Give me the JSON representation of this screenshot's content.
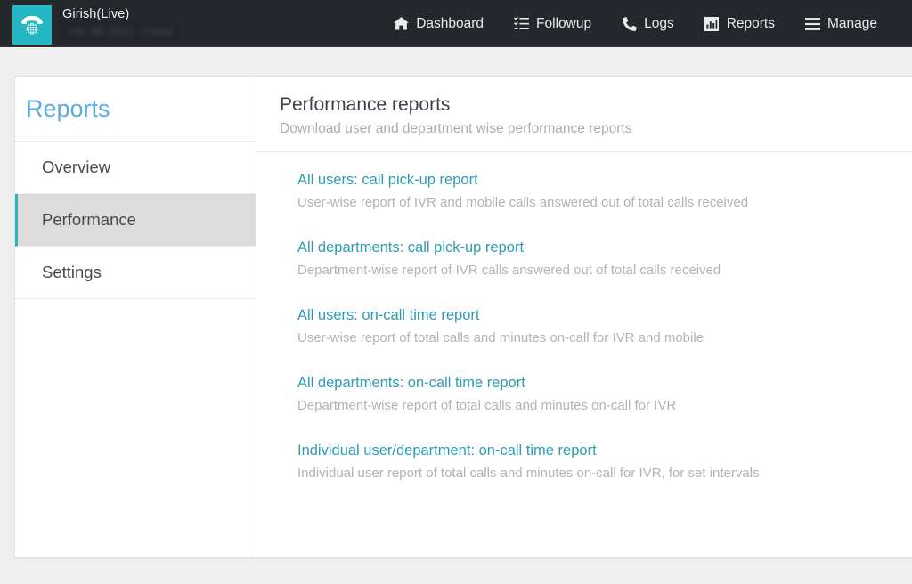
{
  "navbar": {
    "brand": {
      "logo_icon": "telephone-icon",
      "account_name": "Girish(Live)",
      "phone_number": "+91 80 2531 72432"
    },
    "links": [
      {
        "label": "Dashboard",
        "icon": "home-icon"
      },
      {
        "label": "Followup",
        "icon": "tasks-icon"
      },
      {
        "label": "Logs",
        "icon": "phone-icon"
      },
      {
        "label": "Reports",
        "icon": "bar-chart-icon"
      },
      {
        "label": "Manage",
        "icon": "hamburger-icon"
      }
    ]
  },
  "sidebar": {
    "title": "Reports",
    "items": [
      {
        "label": "Overview",
        "active": false
      },
      {
        "label": "Performance",
        "active": true
      },
      {
        "label": "Settings",
        "active": false
      }
    ]
  },
  "content": {
    "title": "Performance reports",
    "subtitle": "Download user and department wise performance reports",
    "reports": [
      {
        "label": "All users: call pick-up report",
        "description": "User-wise report of IVR and mobile calls answered out of total calls received"
      },
      {
        "label": "All departments: call pick-up report",
        "description": "Department-wise report of IVR calls answered out of total calls received"
      },
      {
        "label": "All users: on-call time report",
        "description": "User-wise report of total calls and minutes on-call for IVR and mobile"
      },
      {
        "label": "All departments: on-call time report",
        "description": "Department-wise report of total calls and minutes on-call for IVR"
      },
      {
        "label": "Individual user/department: on-call time report",
        "description": "Individual user report of total calls and minutes on-call for IVR, for set intervals"
      }
    ]
  },
  "colors": {
    "navbar_bg": "#24272c",
    "brand_teal": "#25b7c4",
    "sidebar_title": "#5badde",
    "link_teal": "#2d9cb3",
    "page_bg": "#efefef",
    "active_item_bg": "#dcdcdc"
  }
}
